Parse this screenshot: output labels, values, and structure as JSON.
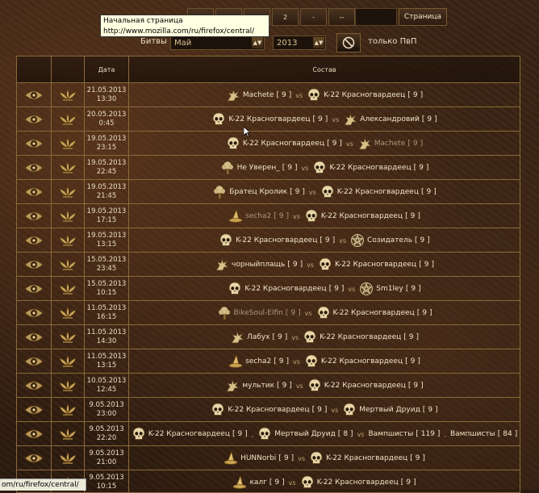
{
  "pager": {
    "buttons": [
      "",
      "",
      "",
      "2",
      "-",
      "--"
    ],
    "go_label": "Страница"
  },
  "tooltip": {
    "title": "Начальная страница",
    "url": "http://www.mozilla.com/ru/firefox/central/"
  },
  "filter": {
    "label": "Битвы за:",
    "month": "Май",
    "year": "2013",
    "pvp_label": "только ПвП"
  },
  "table": {
    "headers": [
      "",
      "",
      "Дата",
      "Состав"
    ],
    "rows": [
      {
        "date": "21.05.2013",
        "time": "13:30",
        "left": [
          {
            "name": "Machete",
            "lvl": "9",
            "icon": "dragon",
            "dim": false
          }
        ],
        "right": [
          {
            "name": "K-22 Красногвардеец",
            "lvl": "9",
            "icon": "skull",
            "dim": false
          }
        ]
      },
      {
        "date": "20.05.2013",
        "time": "0:45",
        "left": [
          {
            "name": "K-22 Красногвардеец",
            "lvl": "9",
            "icon": "skull",
            "dim": false
          }
        ],
        "right": [
          {
            "name": "Александровий",
            "lvl": "9",
            "icon": "dragon",
            "dim": false
          }
        ]
      },
      {
        "date": "19.05.2013",
        "time": "23:15",
        "left": [
          {
            "name": "K-22 Красногвардеец",
            "lvl": "9",
            "icon": "skull",
            "dim": false
          }
        ],
        "right": [
          {
            "name": "Machete",
            "lvl": "9",
            "icon": "dragon",
            "dim": true
          }
        ]
      },
      {
        "date": "19.05.2013",
        "time": "22:45",
        "left": [
          {
            "name": "Не Уверен_",
            "lvl": "9",
            "icon": "tree",
            "dim": false
          }
        ],
        "right": [
          {
            "name": "K-22 Красногвардеец",
            "lvl": "9",
            "icon": "skull",
            "dim": false
          }
        ]
      },
      {
        "date": "19.05.2013",
        "time": "21:45",
        "left": [
          {
            "name": "Братец Кролик",
            "lvl": "9",
            "icon": "tree",
            "dim": false
          }
        ],
        "right": [
          {
            "name": "K-22 Красногвардеец",
            "lvl": "9",
            "icon": "skull",
            "dim": false
          }
        ]
      },
      {
        "date": "19.05.2013",
        "time": "17:15",
        "left": [
          {
            "name": "secha2",
            "lvl": "9",
            "icon": "hat",
            "dim": true
          }
        ],
        "right": [
          {
            "name": "K-22 Красногвардеец",
            "lvl": "9",
            "icon": "skull",
            "dim": false
          }
        ]
      },
      {
        "date": "19.05.2013",
        "time": "13:15",
        "left": [
          {
            "name": "K-22 Красногвардеец",
            "lvl": "9",
            "icon": "skull",
            "dim": false
          }
        ],
        "right": [
          {
            "name": "Созидатель",
            "lvl": "9",
            "icon": "pentagram",
            "dim": false
          }
        ]
      },
      {
        "date": "15.05.2013",
        "time": "23:45",
        "left": [
          {
            "name": "чорныйплащь",
            "lvl": "9",
            "icon": "dragon",
            "dim": false
          }
        ],
        "right": [
          {
            "name": "K-22 Красногвардеец",
            "lvl": "9",
            "icon": "skull",
            "dim": false
          }
        ]
      },
      {
        "date": "15.05.2013",
        "time": "10:15",
        "left": [
          {
            "name": "K-22 Красногвардеец",
            "lvl": "9",
            "icon": "skull",
            "dim": false
          }
        ],
        "right": [
          {
            "name": "Sm1ley",
            "lvl": "9",
            "icon": "pentagram",
            "dim": false
          }
        ]
      },
      {
        "date": "11.05.2013",
        "time": "16:15",
        "left": [
          {
            "name": "BikeSoul-Elfin",
            "lvl": "9",
            "icon": "tree",
            "dim": true
          }
        ],
        "right": [
          {
            "name": "K-22 Красногвардеец",
            "lvl": "9",
            "icon": "skull",
            "dim": false
          }
        ]
      },
      {
        "date": "11.05.2013",
        "time": "14:30",
        "left": [
          {
            "name": "Лабух",
            "lvl": "9",
            "icon": "dragon",
            "dim": false
          }
        ],
        "right": [
          {
            "name": "K-22 Красногвардеец",
            "lvl": "9",
            "icon": "skull",
            "dim": false
          }
        ]
      },
      {
        "date": "11.05.2013",
        "time": "13:15",
        "left": [
          {
            "name": "secha2",
            "lvl": "9",
            "icon": "hat",
            "dim": false
          }
        ],
        "right": [
          {
            "name": "K-22 Красногвардеец",
            "lvl": "9",
            "icon": "skull",
            "dim": false
          }
        ]
      },
      {
        "date": "10.05.2013",
        "time": "12:45",
        "left": [
          {
            "name": "мультик",
            "lvl": "9",
            "icon": "dragon",
            "dim": false
          }
        ],
        "right": [
          {
            "name": "K-22 Красногвардеец",
            "lvl": "9",
            "icon": "skull",
            "dim": false
          }
        ]
      },
      {
        "date": "9.05.2013",
        "time": "23:00",
        "left": [
          {
            "name": "K-22 Красногвардеец",
            "lvl": "9",
            "icon": "skull",
            "dim": false
          }
        ],
        "right": [
          {
            "name": "Мертвый Друид",
            "lvl": "9",
            "icon": "skull",
            "dim": false
          }
        ]
      },
      {
        "date": "9.05.2013",
        "time": "22:20",
        "left": [
          {
            "name": "K-22 Красногвардеец",
            "lvl": "9",
            "icon": "skull",
            "dim": false
          },
          {
            "name": "Мертвый Друид",
            "lvl": "8",
            "icon": "skull",
            "dim": false
          }
        ],
        "right": [
          {
            "name": "Вампшисты",
            "lvl": "119",
            "icon": "",
            "dim": false
          },
          {
            "name": "Вампшисты",
            "lvl": "84",
            "icon": "",
            "dim": false
          }
        ]
      },
      {
        "date": "9.05.2013",
        "time": "21:00",
        "left": [
          {
            "name": "HUNNorbi",
            "lvl": "9",
            "icon": "hat",
            "dim": false
          }
        ],
        "right": [
          {
            "name": "K-22 Красногвардеец",
            "lvl": "9",
            "icon": "skull",
            "dim": false
          }
        ]
      },
      {
        "date": "9.05.2013",
        "time": "10:15",
        "left": [
          {
            "name": "калг",
            "lvl": "9",
            "icon": "hat",
            "dim": false
          }
        ],
        "right": [
          {
            "name": "K-22 Красногвардеец",
            "lvl": "9",
            "icon": "skull",
            "dim": false
          }
        ]
      }
    ]
  },
  "vs_label": "vs",
  "status_bar": {
    "url": "om/ru/firefox/central/"
  }
}
